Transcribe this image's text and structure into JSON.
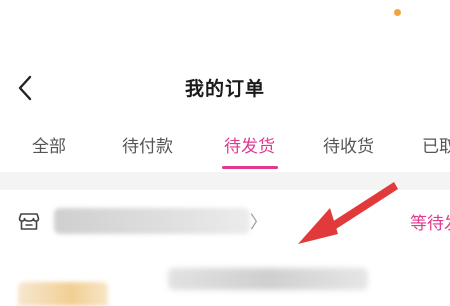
{
  "header": {
    "title": "我的订单",
    "back_icon": "chevron-left-icon"
  },
  "tabs": [
    {
      "label": "全部",
      "active": false
    },
    {
      "label": "待付款",
      "active": false
    },
    {
      "label": "待发货",
      "active": true
    },
    {
      "label": "待收货",
      "active": false
    },
    {
      "label": "已取",
      "active": false
    }
  ],
  "order": {
    "shop_icon": "store-icon",
    "status": "等待发"
  },
  "colors": {
    "accent": "#e0398f",
    "annotation_arrow": "#e23a3a",
    "status_dot": "#f5a33c",
    "divider": "#f4f4f4"
  }
}
